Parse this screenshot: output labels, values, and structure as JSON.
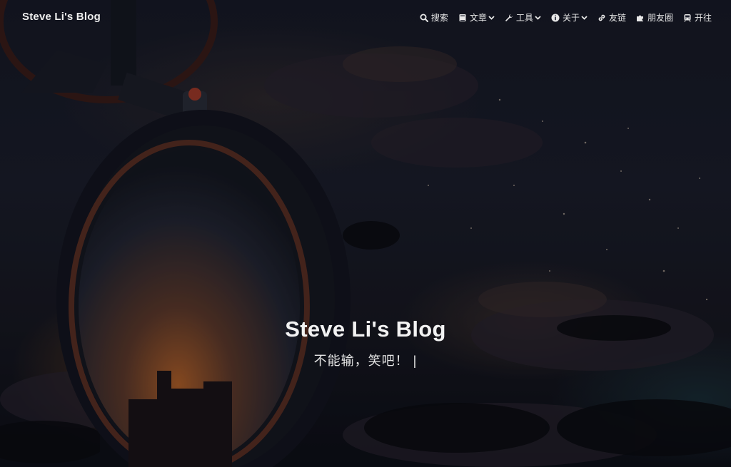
{
  "header": {
    "brand": "Steve Li's Blog"
  },
  "nav": {
    "items": [
      {
        "label": "搜索",
        "icon": "search-icon",
        "dropdown": false
      },
      {
        "label": "文章",
        "icon": "book-icon",
        "dropdown": true
      },
      {
        "label": "工具",
        "icon": "wrench-icon",
        "dropdown": true
      },
      {
        "label": "关于",
        "icon": "info-circle-icon",
        "dropdown": true
      },
      {
        "label": "友链",
        "icon": "link-icon",
        "dropdown": false
      },
      {
        "label": "朋友圈",
        "icon": "puzzle-icon",
        "dropdown": false
      },
      {
        "label": "开往",
        "icon": "train-icon",
        "dropdown": false
      }
    ]
  },
  "hero": {
    "title": "Steve Li's Blog",
    "subtitle": "不能输，笑吧！",
    "cursor": "|"
  },
  "colors": {
    "text": "#eeeeee",
    "sky": "#1b1e2c",
    "mirror_frame": "#5a2f24",
    "sunset": "#b0602a"
  }
}
